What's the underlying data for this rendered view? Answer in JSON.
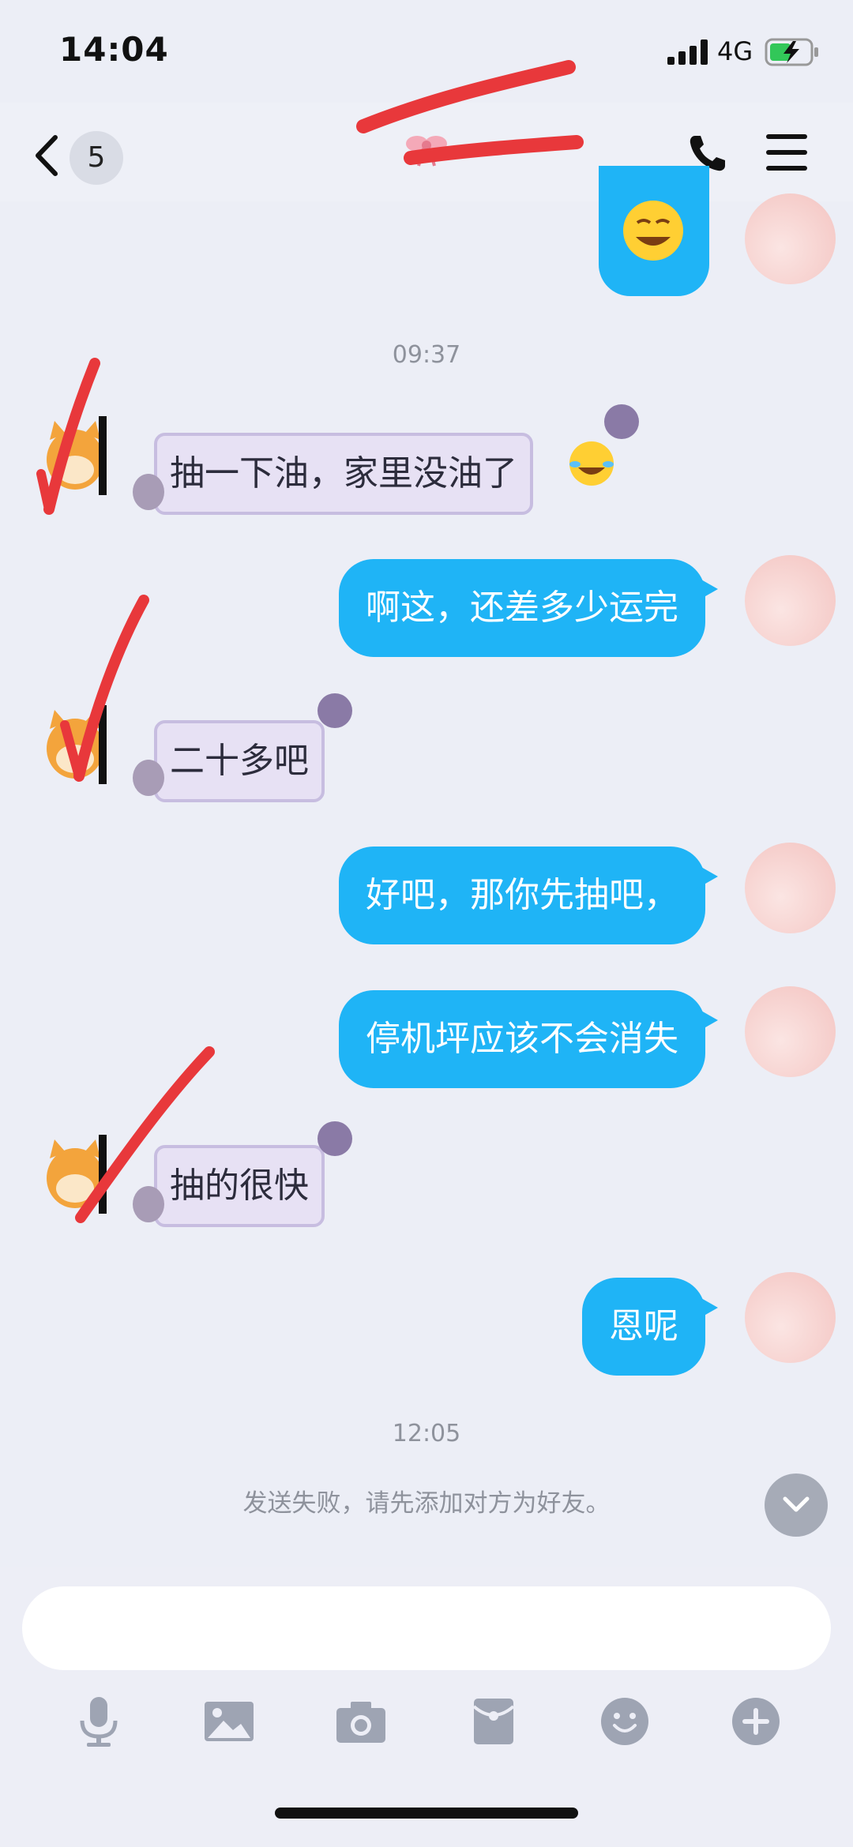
{
  "status_bar": {
    "time": "14:04",
    "network": "4G"
  },
  "header": {
    "unread_count": "5"
  },
  "messages": [
    {
      "time": "09:37"
    },
    {
      "side": "in",
      "text": "抽一下油，家里没油了"
    },
    {
      "side": "out",
      "text": "啊这，还差多少运完"
    },
    {
      "side": "in",
      "text": "二十多吧"
    },
    {
      "side": "out",
      "text": "好吧，那你先抽吧，"
    },
    {
      "side": "out",
      "text": "停机坪应该不会消失"
    },
    {
      "side": "in",
      "text": "抽的很快"
    },
    {
      "side": "out",
      "text": "恩呢"
    },
    {
      "time": "12:05"
    }
  ],
  "notice": "发送失败，请先添加对方为好友。",
  "input": {
    "placeholder": ""
  },
  "colors": {
    "outgoing_bubble": "#1fb4f6",
    "incoming_bubble": "#e7e1f4",
    "scribble": "#e8383b"
  }
}
